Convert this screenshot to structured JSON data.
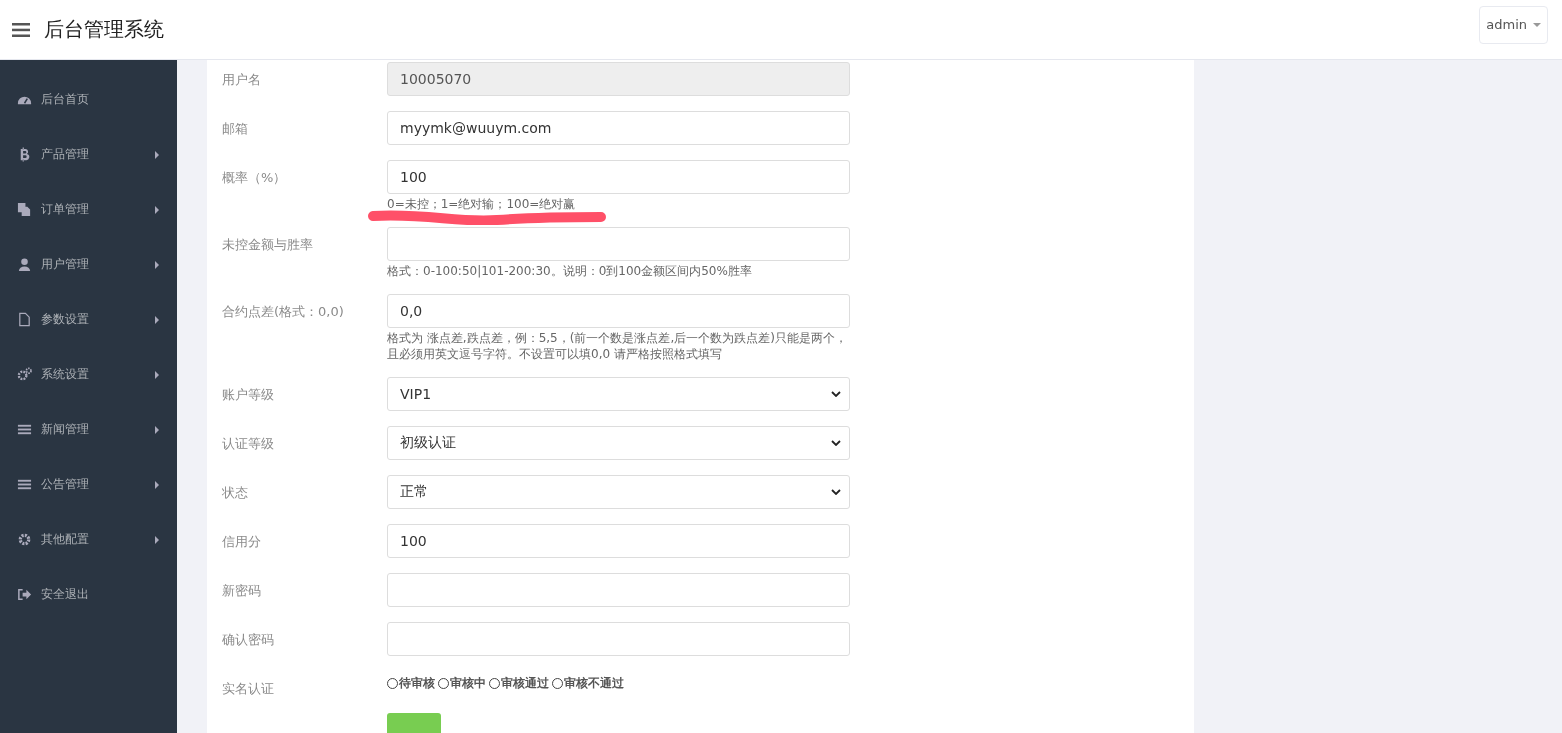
{
  "header": {
    "title": "后台管理系统",
    "user_menu": "admin"
  },
  "sidebar": {
    "items": [
      {
        "label": "后台首页",
        "has_submenu": false
      },
      {
        "label": "产品管理",
        "has_submenu": true
      },
      {
        "label": "订单管理",
        "has_submenu": true
      },
      {
        "label": "用户管理",
        "has_submenu": true
      },
      {
        "label": "参数设置",
        "has_submenu": true
      },
      {
        "label": "系统设置",
        "has_submenu": true
      },
      {
        "label": "新闻管理",
        "has_submenu": true
      },
      {
        "label": "公告管理",
        "has_submenu": true
      },
      {
        "label": "其他配置",
        "has_submenu": true
      },
      {
        "label": "安全退出",
        "has_submenu": false
      }
    ]
  },
  "form": {
    "fields": [
      {
        "kind": "text",
        "label": "用户名",
        "value": "10005070",
        "disabled": true
      },
      {
        "kind": "text",
        "label": "邮箱",
        "value": "myymk@wuuym.com",
        "disabled": false
      },
      {
        "kind": "text",
        "label": "概率（%）",
        "value": "100",
        "disabled": false,
        "hint": "0=未控；1=绝对输；100=绝对赢",
        "marked": true
      },
      {
        "kind": "text",
        "label": "未控金额与胜率",
        "disabled": false,
        "hint": "格式：0-100:50|101-200:30。说明：0到100金额区间内50%胜率"
      },
      {
        "kind": "text",
        "label": "合约点差(格式：0,0)",
        "value": "0,0",
        "disabled": false,
        "hint": "格式为 涨点差,跌点差，例：5,5，(前一个数是涨点差,后一个数为跌点差)只能是两个，且必须用英文逗号字符。不设置可以填0,0 请严格按照格式填写"
      },
      {
        "kind": "select",
        "label": "账户等级",
        "value": "VIP1"
      },
      {
        "kind": "select",
        "label": "认证等级",
        "value": "初级认证"
      },
      {
        "kind": "select",
        "label": "状态",
        "value": "正常"
      },
      {
        "kind": "text",
        "label": "信用分",
        "value": "100",
        "disabled": false
      },
      {
        "kind": "text",
        "label": "新密码",
        "disabled": false
      },
      {
        "kind": "text",
        "label": "确认密码",
        "disabled": false
      },
      {
        "kind": "radio",
        "label": "实名认证",
        "options": [
          {
            "label": "待审核",
            "selected": false
          },
          {
            "label": "审核中",
            "selected": false
          },
          {
            "label": "审核通过",
            "selected": false
          },
          {
            "label": "审核不通过",
            "selected": false
          }
        ]
      }
    ]
  }
}
